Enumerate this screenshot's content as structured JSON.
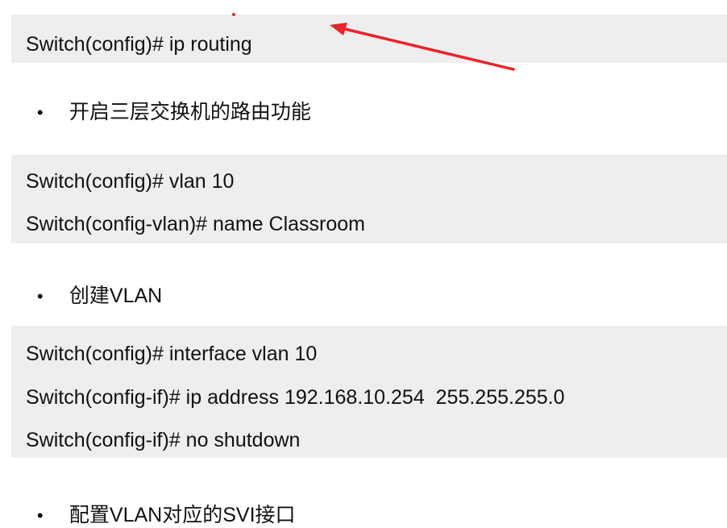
{
  "sections": [
    {
      "commands": [
        "Switch(config)# ip routing"
      ],
      "note": "开启三层交换机的路由功能"
    },
    {
      "commands": [
        "Switch(config)# vlan 10",
        "Switch(config-vlan)# name Classroom"
      ],
      "note": "创建VLAN"
    },
    {
      "commands": [
        "Switch(config)# interface vlan 10",
        "Switch(config-if)# ip address 192.168.10.254  255.255.255.0",
        "Switch(config-if)# no shutdown"
      ],
      "note": "配置VLAN对应的SVI接口"
    }
  ],
  "bullet": "•",
  "annotation": {
    "shape": "arrow",
    "color": "#e8232a"
  }
}
